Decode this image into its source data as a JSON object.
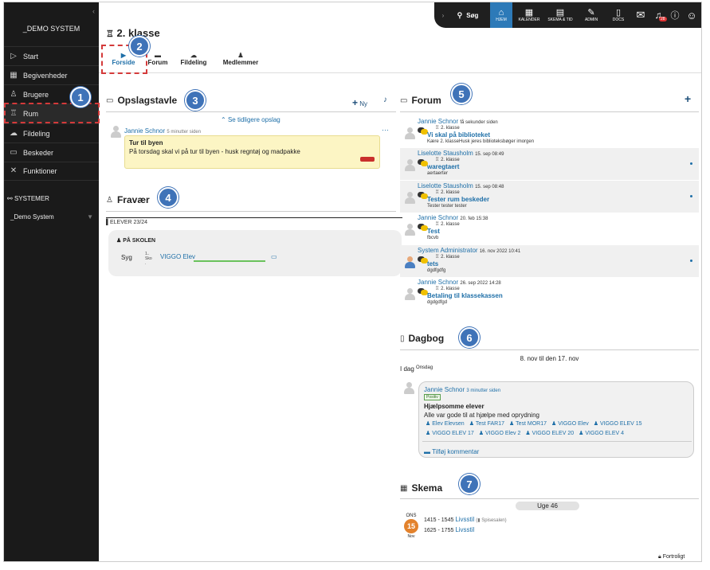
{
  "sidebar": {
    "brand": "_DEMO SYSTEM",
    "items": [
      {
        "icon": "play-icon",
        "label": "Start"
      },
      {
        "icon": "calendar-icon",
        "label": "Begivenheder"
      },
      {
        "icon": "users-icon",
        "label": "Brugere"
      },
      {
        "icon": "room-icon",
        "label": "Rum"
      },
      {
        "icon": "share-icon",
        "label": "Fildeling"
      },
      {
        "icon": "chat-icon",
        "label": "Beskeder"
      },
      {
        "icon": "tools-icon",
        "label": "Funktioner"
      }
    ],
    "systems_label": "SYSTEMER",
    "system_name": "_Demo System"
  },
  "topbar": {
    "search": "Søg",
    "items": [
      "HJEM",
      "KALENDER",
      "SKEMA & TID",
      "ADMIN",
      "DOCS"
    ],
    "notif_count": "28"
  },
  "room": {
    "title": "2. klasse",
    "tabs": [
      "Forside",
      "Forum",
      "Fildeling",
      "Medlemmer"
    ]
  },
  "badges": [
    "1",
    "2",
    "3",
    "4",
    "5",
    "6",
    "7"
  ],
  "opslag": {
    "title": "Opslagstavle",
    "new_label": "Ny",
    "earlier": "Se tidligere opslag",
    "author": "Jannie Schnor",
    "time": "5 minutter siden",
    "more": "···",
    "post_title": "Tur til byen",
    "post_body": "På torsdag skal vi på tur til byen - husk regntøj og madpakke"
  },
  "fravaer": {
    "title": "Fravær",
    "students": "ELEVER 23/24",
    "group": "PÅ SKOLEN",
    "status": "Syg",
    "mini1": "1..",
    "mini2": "Sko",
    "mini3": ".",
    "student": "VIGGO Elev"
  },
  "forum": {
    "title": "Forum",
    "posts": [
      {
        "author": "Jannie Schnor",
        "time": "få sekunder siden",
        "class": "2. klasse",
        "title": "Vi skal på biblioteket",
        "snippet": "Kære 2. klasseHusk jeres biblioteksbøger imorgen",
        "dot": false
      },
      {
        "author": "Liselotte Stausholm",
        "time": "15. sep 08:49",
        "class": "2. klasse",
        "title": "waregtaert",
        "snippet": "aertaerter",
        "dot": true
      },
      {
        "author": "Liselotte Stausholm",
        "time": "15. sep 08:48",
        "class": "2. klasse",
        "title": "Tester rum beskeder",
        "snippet": "Tester tester tester",
        "dot": true
      },
      {
        "author": "Jannie Schnor",
        "time": "20. feb 15:38",
        "class": "2. klasse",
        "title": "Test",
        "snippet": "fbcvb",
        "dot": false
      },
      {
        "author": "System Administrator",
        "time": "16. nov 2022 10:41",
        "class": "2. klasse",
        "title": "tets",
        "snippet": "dgdfgdfg",
        "dot": true
      },
      {
        "author": "Jannie Schnor",
        "time": "26. sep 2022 14:28",
        "class": "2. klasse",
        "title": "Betaling til klassekassen",
        "snippet": "dgdgdfgd",
        "dot": false
      }
    ]
  },
  "dagbog": {
    "title": "Dagbog",
    "range": "8. nov til den 17. nov",
    "today": "I dag",
    "weekday": "Onsdag",
    "author": "Jannie Schnor",
    "time": "3 minutter siden",
    "tag": "Positiv",
    "entry_title": "Hjælpsomme elever",
    "entry_body": "Alle var gode til at hjælpe med oprydning",
    "students": [
      "Elev Elevsen",
      "Test FAR17",
      "Test MOR17",
      "VIGGO Elev",
      "VIGGO ELEV 15",
      "VIGGO ELEV 17",
      "VIGGO Elev 2",
      "VIGGO ELEV 20",
      "VIGGO ELEV 4"
    ],
    "comment": "Tilføj kommentar"
  },
  "skema": {
    "title": "Skema",
    "week": "Uge 46",
    "day_abbr": "ONS",
    "day_num": "15",
    "month": "Nov",
    "lessons": [
      {
        "time": "1415 - 1545",
        "name": "Livsstil",
        "room": "Spisesalen"
      },
      {
        "time": "1625 - 1755",
        "name": "Livsstil",
        "room": ""
      }
    ]
  },
  "footer": {
    "private": "Fortroligt"
  }
}
